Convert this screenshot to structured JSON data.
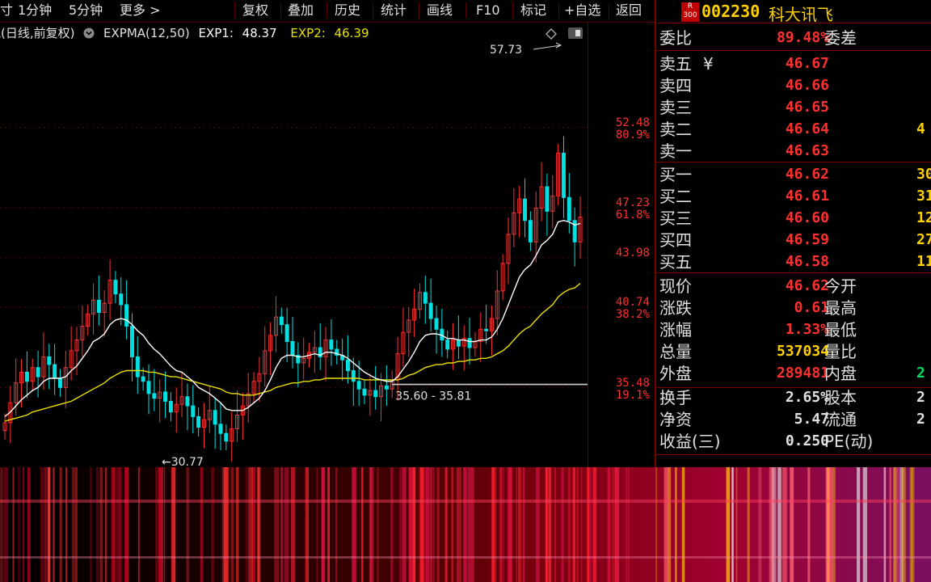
{
  "toolbar": {
    "left_partial": "寸",
    "items": [
      "1分钟",
      "5分钟",
      "更多 >",
      "复权",
      "叠加",
      "历史",
      "统计",
      "画线",
      "F10",
      "标记",
      "+自选",
      "返回"
    ]
  },
  "stock": {
    "badge_top": "R",
    "badge_bottom": "300",
    "code": "002230",
    "name": "科大讯飞"
  },
  "legend": {
    "chart_name": "讯(日线,前复权)",
    "indicator": "EXPMA(12,50)",
    "exp1_label": "EXP1:",
    "exp1_value": "48.37",
    "exp2_label": "EXP2:",
    "exp2_value": "46.39"
  },
  "colors": {
    "up": "#ff3030",
    "down": "#00e0e0",
    "exp1": "#ffffff",
    "exp2": "#e8e000",
    "label": "#e0e0e0",
    "volume": "#ffd000"
  },
  "chart_data": {
    "type": "candlestick",
    "price_axis": [
      {
        "price": "52.48",
        "pct": "80.9%"
      },
      {
        "price": "47.23",
        "pct": "61.8%"
      },
      {
        "price": "43.98",
        "pct": ""
      },
      {
        "price": "40.74",
        "pct": "38.2%"
      },
      {
        "price": "35.48",
        "pct": "19.1%"
      }
    ],
    "ylim": [
      30.77,
      57.73
    ],
    "high_marker": "57.73",
    "low_marker": "30.77",
    "range_annotation": "35.60 - 35.81",
    "close_series": [
      33.2,
      34.5,
      35.8,
      36.5,
      35.9,
      36.8,
      36.2,
      37.5,
      37.0,
      36.1,
      35.5,
      36.8,
      37.9,
      38.6,
      39.5,
      40.3,
      41.2,
      40.4,
      41.0,
      42.5,
      41.6,
      40.9,
      39.5,
      37.5,
      36.2,
      35.9,
      35.1,
      34.8,
      35.2,
      34.6,
      33.9,
      34.4,
      34.9,
      34.3,
      33.6,
      32.9,
      33.4,
      34.0,
      33.1,
      32.5,
      32.0,
      32.8,
      33.7,
      34.3,
      35.1,
      35.9,
      36.4,
      37.9,
      38.9,
      40.1,
      39.6,
      38.5,
      37.6,
      37.1,
      37.4,
      37.8,
      38.1,
      37.5,
      38.6,
      38.0,
      37.6,
      37.3,
      36.6,
      35.9,
      35.4,
      35.0,
      35.3,
      34.9,
      35.6,
      35.4,
      36.0,
      37.7,
      39.1,
      39.9,
      40.6,
      41.7,
      41.0,
      40.0,
      39.3,
      38.6,
      38.0,
      38.6,
      38.2,
      38.7,
      38.1,
      38.5,
      39.3,
      39.2,
      40.0,
      41.8,
      43.6,
      45.5,
      46.9,
      47.8,
      46.4,
      45.0,
      47.2,
      48.6,
      47.0,
      48.0,
      50.8,
      47.9,
      46.4,
      45.0,
      46.62
    ],
    "exp1_series": [
      33.6,
      33.9,
      34.3,
      34.7,
      35.0,
      35.3,
      35.5,
      35.9,
      36.1,
      36.1,
      36.1,
      36.2,
      36.6,
      36.9,
      37.4,
      37.9,
      38.5,
      38.7,
      39.0,
      39.6,
      39.9,
      40.0,
      39.9,
      39.6,
      39.2,
      38.9,
      38.4,
      38.0,
      37.7,
      37.3,
      36.9,
      36.6,
      36.5,
      36.2,
      35.9,
      35.5,
      35.3,
      35.1,
      34.8,
      34.5,
      34.1,
      34.0,
      34.0,
      34.0,
      34.2,
      34.5,
      34.8,
      35.3,
      36.0,
      36.8,
      37.4,
      37.6,
      37.6,
      37.5,
      37.5,
      37.6,
      37.7,
      37.6,
      37.8,
      37.8,
      37.7,
      37.6,
      37.4,
      37.1,
      36.8,
      36.5,
      36.3,
      36.1,
      36.0,
      35.9,
      35.9,
      36.2,
      36.7,
      37.2,
      37.8,
      38.5,
      38.9,
      39.0,
      39.0,
      38.9,
      38.7,
      38.7,
      38.6,
      38.6,
      38.5,
      38.5,
      38.6,
      38.6,
      38.8,
      39.3,
      40.0,
      40.9,
      41.8,
      42.7,
      43.2,
      43.5,
      44.1,
      44.8,
      45.1,
      45.5,
      46.3,
      46.4,
      46.3,
      46.1,
      46.2
    ],
    "exp2_series": [
      33.3,
      33.4,
      33.5,
      33.6,
      33.7,
      33.9,
      34.0,
      34.1,
      34.2,
      34.3,
      34.4,
      34.5,
      34.6,
      34.8,
      35.0,
      35.2,
      35.4,
      35.6,
      35.8,
      36.1,
      36.3,
      36.5,
      36.6,
      36.6,
      36.6,
      36.6,
      36.5,
      36.5,
      36.4,
      36.3,
      36.2,
      36.2,
      36.1,
      36.0,
      35.9,
      35.8,
      35.7,
      35.6,
      35.5,
      35.4,
      35.2,
      35.1,
      35.1,
      35.0,
      35.0,
      35.0,
      35.1,
      35.2,
      35.3,
      35.5,
      35.6,
      35.7,
      35.8,
      35.8,
      35.9,
      35.9,
      36.0,
      36.0,
      36.1,
      36.1,
      36.1,
      36.1,
      36.1,
      36.1,
      36.1,
      36.0,
      36.0,
      36.0,
      36.0,
      36.0,
      36.0,
      36.0,
      36.1,
      36.3,
      36.4,
      36.6,
      36.8,
      36.9,
      37.0,
      37.0,
      37.1,
      37.1,
      37.2,
      37.2,
      37.3,
      37.3,
      37.4,
      37.4,
      37.5,
      37.7,
      37.9,
      38.2,
      38.6,
      39.0,
      39.3,
      39.5,
      39.9,
      40.3,
      40.6,
      40.9,
      41.4,
      41.7,
      41.9,
      42.0,
      42.3
    ]
  },
  "order_book": {
    "ratio": {
      "label": "委比",
      "value": "89.48%",
      "label2": "委差"
    },
    "sells": [
      {
        "label": "卖五",
        "price": "46.67",
        "vol": ""
      },
      {
        "label": "卖四",
        "price": "46.66",
        "vol": ""
      },
      {
        "label": "卖三",
        "price": "46.65",
        "vol": ""
      },
      {
        "label": "卖二",
        "price": "46.64",
        "vol": "4"
      },
      {
        "label": "卖一",
        "price": "46.63",
        "vol": ""
      }
    ],
    "buys": [
      {
        "label": "买一",
        "price": "46.62",
        "vol": "30"
      },
      {
        "label": "买二",
        "price": "46.61",
        "vol": "31"
      },
      {
        "label": "买三",
        "price": "46.60",
        "vol": "12"
      },
      {
        "label": "买四",
        "price": "46.59",
        "vol": "27"
      },
      {
        "label": "买五",
        "price": "46.58",
        "vol": "11"
      }
    ],
    "yen_mark": "¥"
  },
  "quote": [
    {
      "label": "现价",
      "value": "46.62",
      "label2": "今开",
      "value2": ""
    },
    {
      "label": "涨跌",
      "value": "0.61",
      "label2": "最高",
      "value2": ""
    },
    {
      "label": "涨幅",
      "value": "1.33%",
      "label2": "最低",
      "value2": ""
    },
    {
      "label": "总量",
      "value": "537034",
      "label2": "量比",
      "value2": ""
    },
    {
      "label": "外盘",
      "value": "289481",
      "label2": "内盘",
      "value2": "2"
    }
  ],
  "fundamentals": [
    {
      "label": "换手",
      "value": "2.65%",
      "label2": "股本",
      "value2": "2"
    },
    {
      "label": "净资",
      "value": "5.47",
      "label2": "流通",
      "value2": "2"
    },
    {
      "label": "收益(三)",
      "value": "0.250",
      "label2": "PE(动)",
      "value2": ""
    }
  ]
}
